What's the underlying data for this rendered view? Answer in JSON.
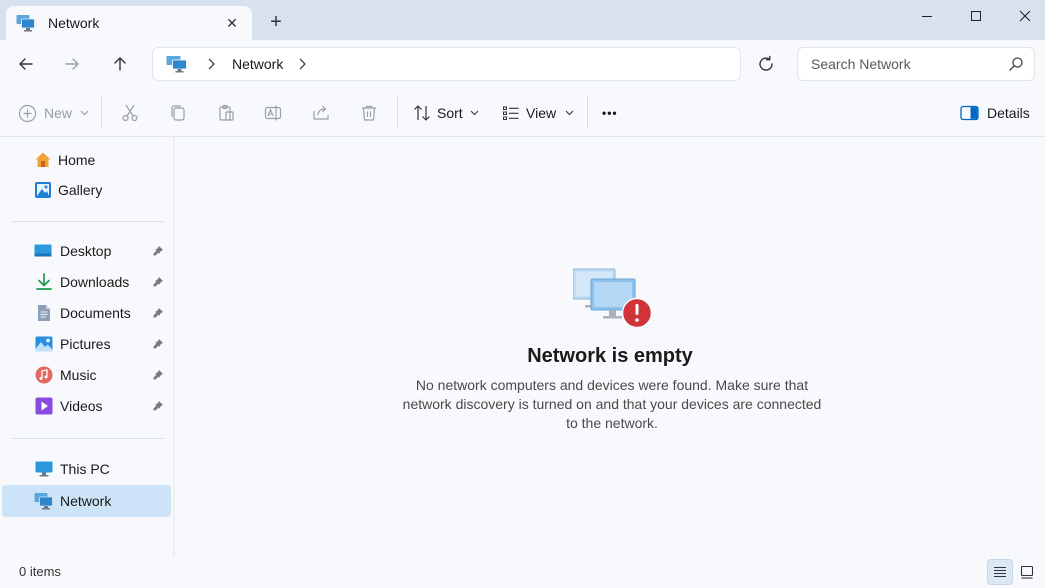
{
  "window": {
    "tab_title": "Network",
    "new_tab_label": "+",
    "tab_close_label": "✕"
  },
  "navigation": {
    "breadcrumb": [
      "Network"
    ]
  },
  "search": {
    "placeholder": "Search Network"
  },
  "toolbar": {
    "new_label": "New",
    "sort_label": "Sort",
    "view_label": "View",
    "more_label": "•••",
    "details_label": "Details"
  },
  "sidebar": {
    "top": [
      {
        "label": "Home",
        "icon": "home-icon"
      },
      {
        "label": "Gallery",
        "icon": "gallery-icon"
      }
    ],
    "pinned": [
      {
        "label": "Desktop",
        "icon": "desktop-folder-icon"
      },
      {
        "label": "Downloads",
        "icon": "downloads-icon"
      },
      {
        "label": "Documents",
        "icon": "documents-icon"
      },
      {
        "label": "Pictures",
        "icon": "pictures-icon"
      },
      {
        "label": "Music",
        "icon": "music-icon"
      },
      {
        "label": "Videos",
        "icon": "videos-icon"
      }
    ],
    "locations": [
      {
        "label": "This PC",
        "icon": "this-pc-icon"
      },
      {
        "label": "Network",
        "icon": "network-icon",
        "selected": true
      }
    ]
  },
  "content": {
    "empty_title": "Network is empty",
    "empty_message": "No network computers and devices were found. Make sure that network discovery is turned on and that your devices are connected to the network."
  },
  "status": {
    "item_count": "0 items"
  },
  "colors": {
    "accent": "#0067c0",
    "selected_bg": "#cde3f7",
    "error_badge": "#d13438"
  }
}
